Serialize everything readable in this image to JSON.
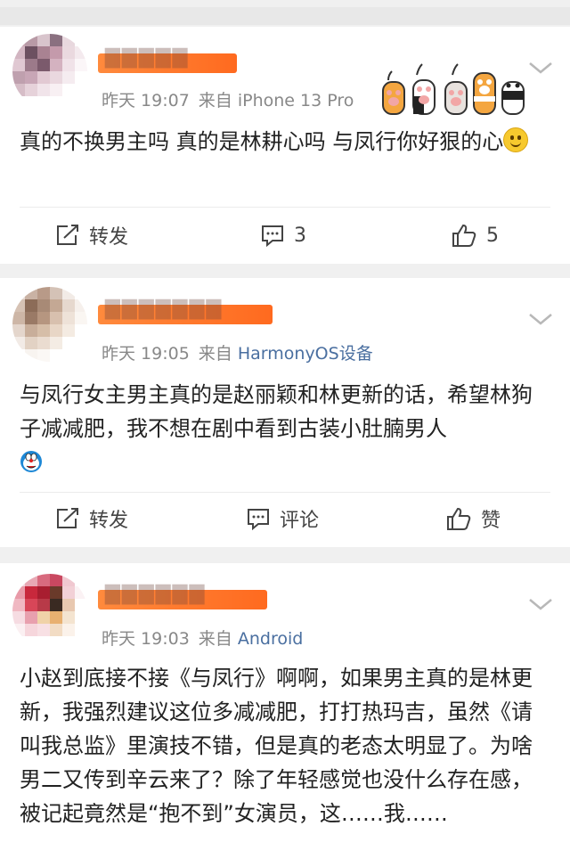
{
  "posts": [
    {
      "time": "昨天 19:07",
      "source_prefix": "来自",
      "device": "iPhone 13 Pro",
      "content": "真的不换男主吗 真的是林耕心吗 与凤行你好狠的心",
      "actions": {
        "repost": "转发",
        "comment": "3",
        "like": "5"
      },
      "avatar_colors": [
        "#c9a8b4",
        "#b89aa6",
        "#d8c4cc",
        "#8a7080",
        "#e8d8de",
        "#ffffff",
        "#d2b5c1",
        "#6c5060",
        "#a98292",
        "#c49aab",
        "#ead9df",
        "#f4eaee",
        "#e0c8d2",
        "#9c7a8a",
        "#7b5a6c",
        "#d4b2c0",
        "#f0e2e8",
        "#fbf6f8",
        "#bfa0ae",
        "#c8a6b6",
        "#e2c9d3",
        "#ead8df",
        "#f5ecf0",
        "#ffffff",
        "#d6bdc7",
        "#e6d2da",
        "#f1e4ea",
        "#f8f0f3",
        "#ffffff",
        "#ffffff",
        "#ffffff",
        "#ffffff",
        "#ffffff",
        "#ffffff",
        "#ffffff",
        "#ffffff"
      ]
    },
    {
      "time": "昨天 19:05",
      "source_prefix": "来自",
      "device": "HarmonyOS设备",
      "content": "与凤行女主男主真的是赵丽颖和林更新的话，希望林狗子减减肥，我不想在剧中看到古装小肚腩男人",
      "actions": {
        "repost": "转发",
        "comment": "评论",
        "like": "赞"
      },
      "avatar_colors": [
        "#e8dcd6",
        "#c9b2a4",
        "#b89a88",
        "#d4c2b6",
        "#f2ebe6",
        "#ffffff",
        "#d6c2b4",
        "#8c6c58",
        "#a88a76",
        "#c4a894",
        "#e6d8ce",
        "#f6f0ec",
        "#cdb6a6",
        "#9a7a66",
        "#b69680",
        "#d8c0ae",
        "#eee2d8",
        "#faf6f2",
        "#e4d6cc",
        "#c8ae9a",
        "#d6bea8",
        "#e8d6c6",
        "#f4ebe2",
        "#ffffff",
        "#f2ebe6",
        "#e2d2c4",
        "#eadcd0",
        "#f4ece4",
        "#ffffff",
        "#ffffff",
        "#ffffff",
        "#f8f4f0",
        "#fbf8f5",
        "#ffffff",
        "#ffffff",
        "#ffffff"
      ]
    },
    {
      "time": "昨天 19:03",
      "source_prefix": "来自",
      "device": "Android",
      "content": "小赵到底接不接《与凤行》啊啊，如果男主真的是林更新，我强烈建议这位多减减肥，打打热玛吉，虽然《请叫我总监》里演技不错，但是真的老态太明显了。为啥男二又传到辛云来了？除了年轻感觉也没什么存在感，被记起竟然是“抱不到”女演员，这……我……",
      "avatar_colors": [
        "#f4d6dc",
        "#e8a8b4",
        "#d86a7e",
        "#c94860",
        "#f0c8d0",
        "#ffffff",
        "#e89aa8",
        "#c8283c",
        "#a81e30",
        "#6a3a2a",
        "#f2d0d6",
        "#fbf2f4",
        "#f0b8c2",
        "#d84658",
        "#b83a48",
        "#3a2a22",
        "#e8c8b0",
        "#ffffff",
        "#f6dce2",
        "#e8a0ae",
        "#f0d2a8",
        "#e8b070",
        "#f4e4d0",
        "#ffffff",
        "#fbf0f2",
        "#f6d6dc",
        "#f8e0e4",
        "#f2dcc4",
        "#fbf2ea",
        "#ffffff",
        "#ffffff",
        "#ffffff",
        "#ffffff",
        "#ffffff",
        "#ffffff",
        "#ffffff"
      ]
    }
  ],
  "colors": {
    "accent_orange": "#ff7a2e",
    "link_blue": "#4a6fa0",
    "meta_gray": "#888888"
  }
}
